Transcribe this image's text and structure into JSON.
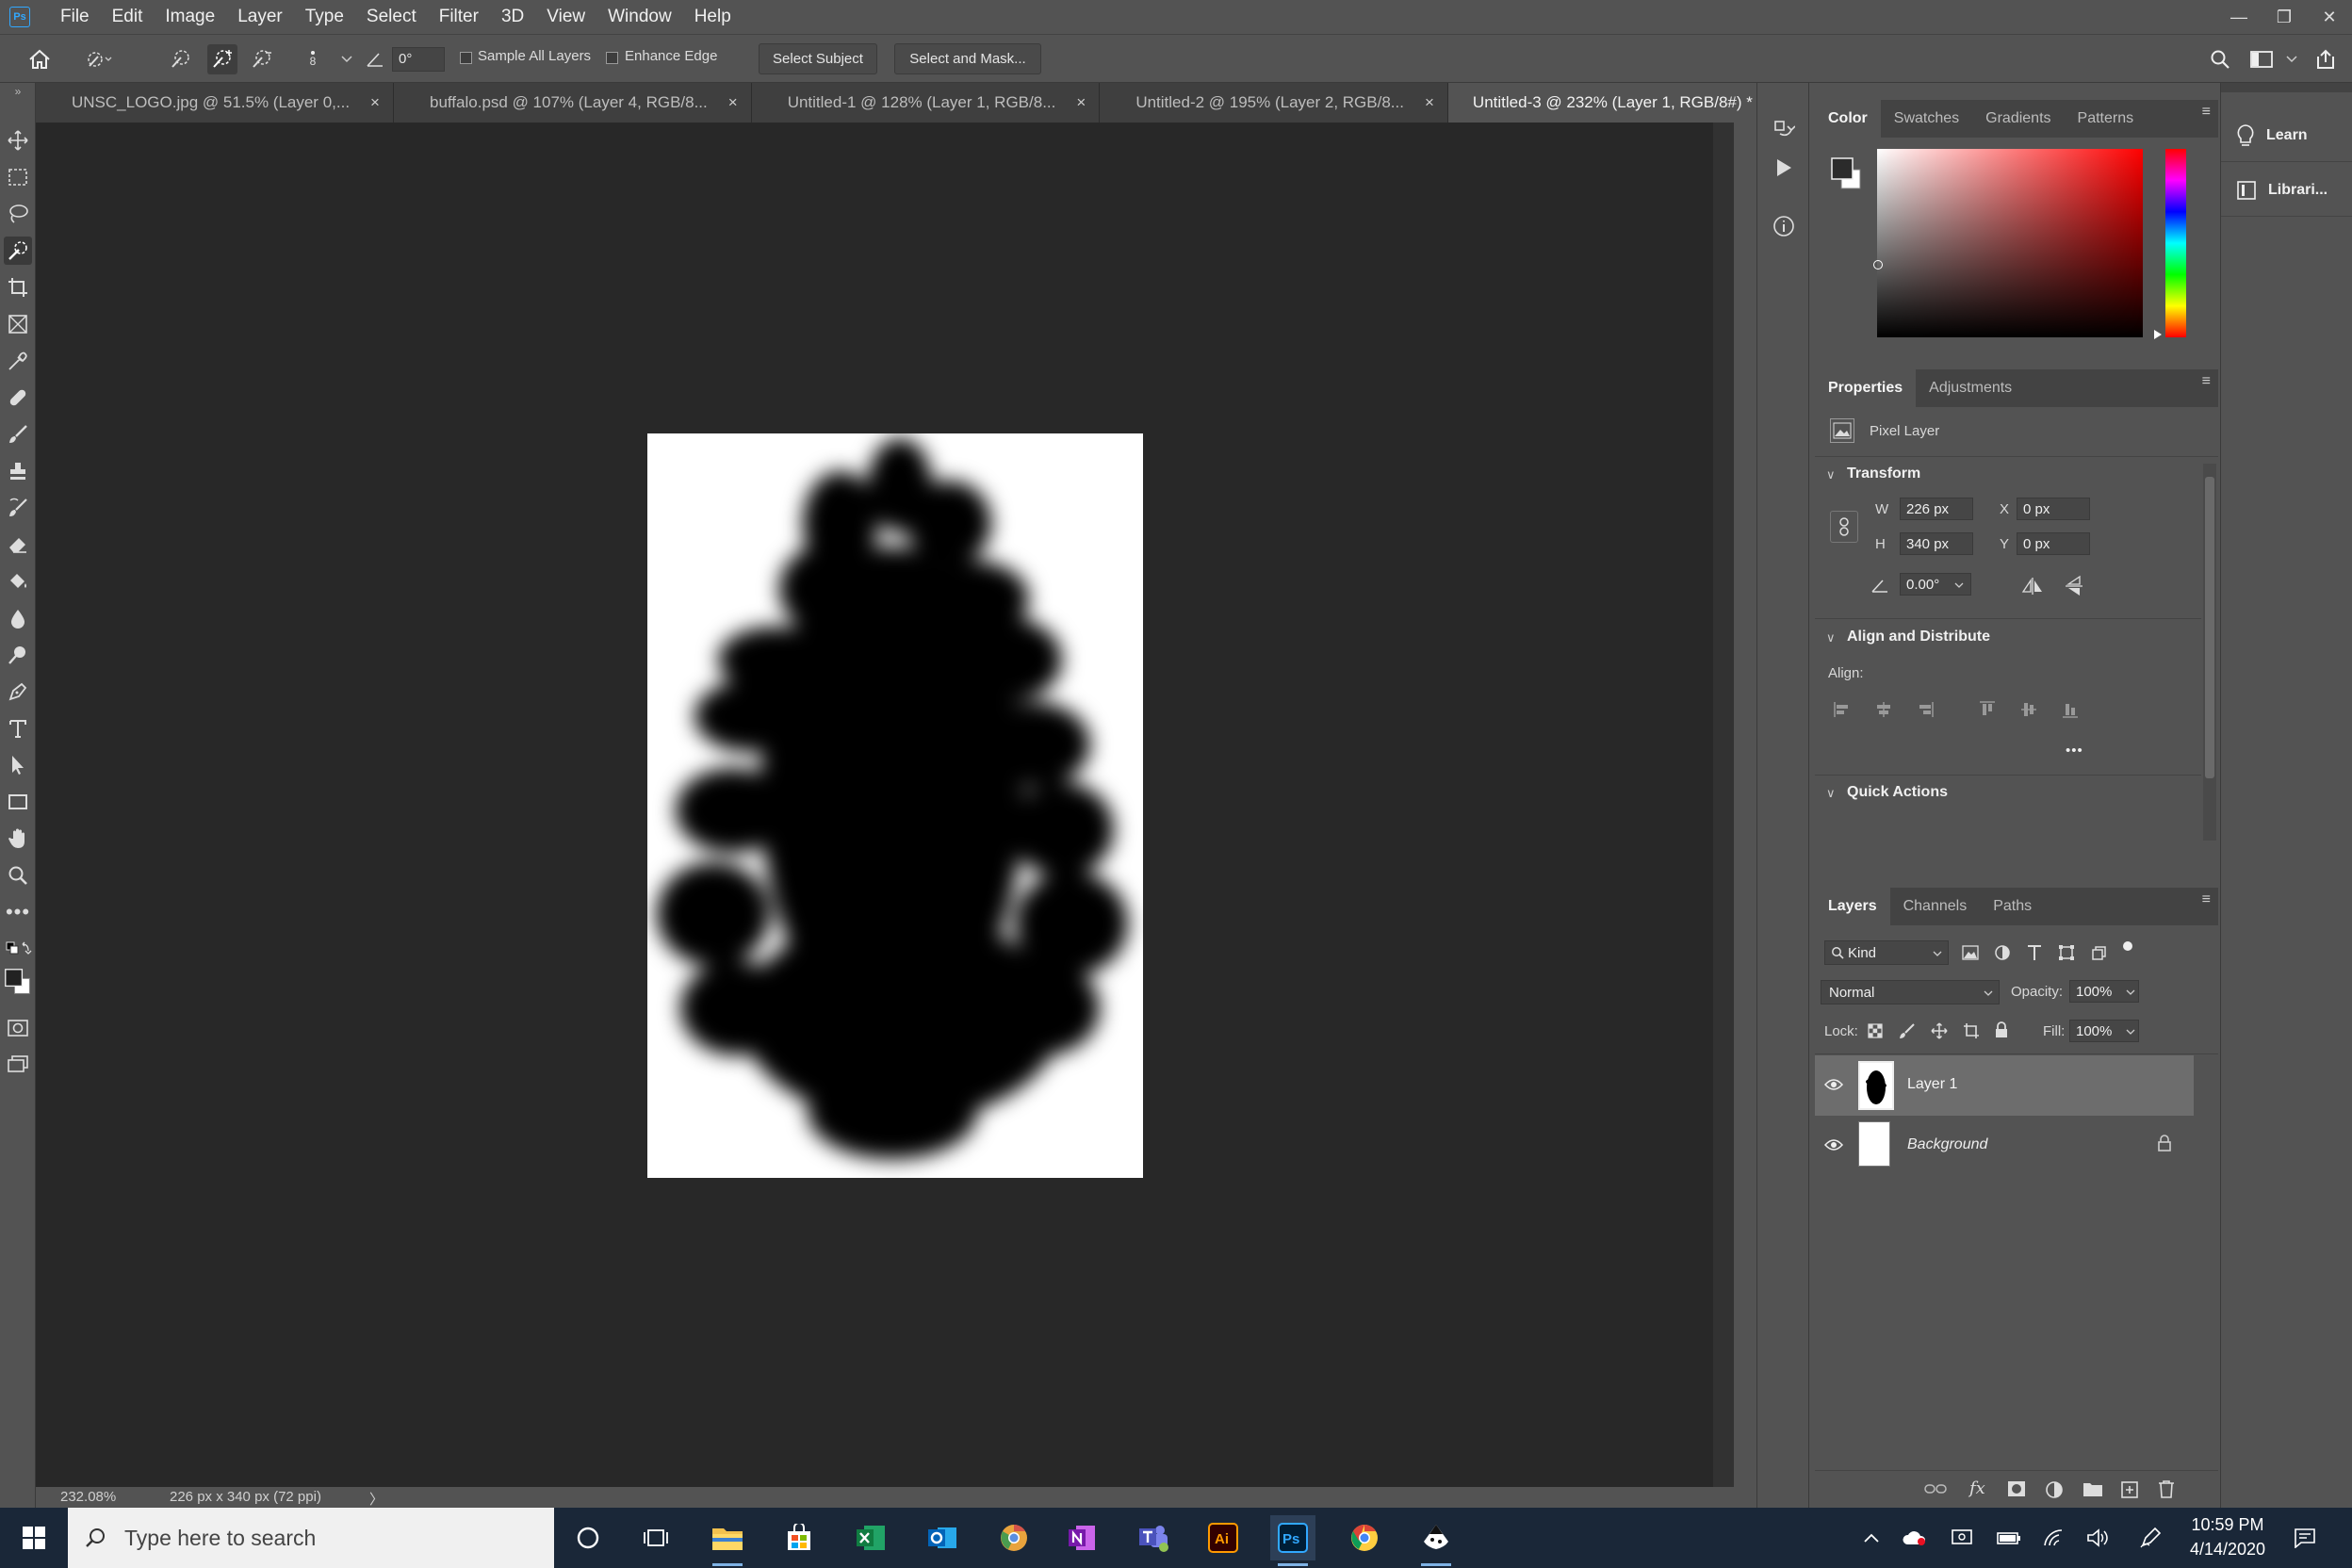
{
  "menubar": {
    "app_logo": "Ps",
    "items": [
      "File",
      "Edit",
      "Image",
      "Layer",
      "Type",
      "Select",
      "Filter",
      "3D",
      "View",
      "Window",
      "Help"
    ]
  },
  "options": {
    "brush_size": "8",
    "angle": "0°",
    "sample_all_layers": "Sample All Layers",
    "enhance_edge": "Enhance Edge",
    "select_subject": "Select Subject",
    "select_and_mask": "Select and Mask..."
  },
  "tabs": [
    {
      "label": "UNSC_LOGO.jpg @ 51.5% (Layer 0,...",
      "active": false
    },
    {
      "label": "buffalo.psd @ 107% (Layer 4, RGB/8...",
      "active": false
    },
    {
      "label": "Untitled-1 @ 128% (Layer 1, RGB/8...",
      "active": false
    },
    {
      "label": "Untitled-2 @ 195% (Layer 2, RGB/8...",
      "active": false
    },
    {
      "label": "Untitled-3 @ 232% (Layer 1, RGB/8#) *",
      "active": true
    }
  ],
  "tab_close": "×",
  "status": {
    "zoom": "232.08%",
    "doc_size": "226 px x 340 px (72 ppi)",
    "arrow": "〉"
  },
  "color_panel": {
    "tabs": [
      "Color",
      "Swatches",
      "Gradients",
      "Patterns"
    ],
    "hue_color": "#ff0000"
  },
  "properties_panel": {
    "tabs": [
      "Properties",
      "Adjustments"
    ],
    "layer_type": "Pixel Layer",
    "transform_title": "Transform",
    "w_label": "W",
    "w_value": "226 px",
    "h_label": "H",
    "h_value": "340 px",
    "x_label": "X",
    "x_value": "0 px",
    "y_label": "Y",
    "y_value": "0 px",
    "angle_value": "0.00°",
    "align_title": "Align and Distribute",
    "align_label": "Align:",
    "more": "•••",
    "quick_actions_title": "Quick Actions"
  },
  "layers_panel": {
    "tabs": [
      "Layers",
      "Channels",
      "Paths"
    ],
    "filter_kind": "Kind",
    "blend_mode": "Normal",
    "opacity_label": "Opacity:",
    "opacity_value": "100%",
    "lock_label": "Lock:",
    "fill_label": "Fill:",
    "fill_value": "100%",
    "layers": [
      {
        "name": "Layer 1",
        "selected": true,
        "visible": true
      },
      {
        "name": "Background",
        "selected": false,
        "visible": true,
        "locked": true
      }
    ],
    "footer_fx": "fx"
  },
  "learn_panel": {
    "learn": "Learn",
    "libraries": "Librari..."
  },
  "taskbar": {
    "search_placeholder": "Type here to search",
    "time": "10:59 PM",
    "date": "4/14/2020",
    "apps": [
      "task-view",
      "file-explorer",
      "store",
      "excel",
      "outlook",
      "chrome-canary",
      "onenote",
      "teams",
      "illustrator",
      "photoshop",
      "chrome",
      "inkscape"
    ]
  }
}
